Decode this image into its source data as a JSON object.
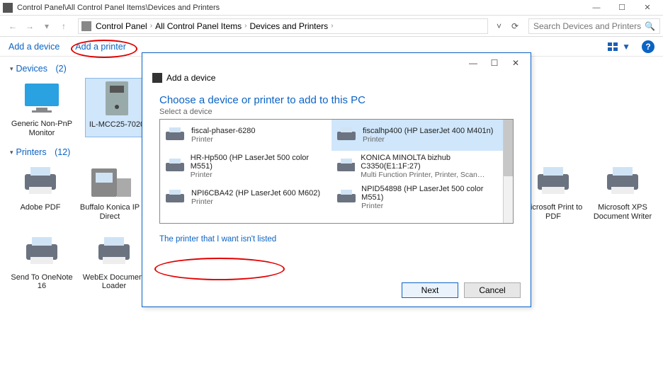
{
  "window": {
    "title": "Control Panel\\All Control Panel Items\\Devices and Printers"
  },
  "breadcrumbs": {
    "items": [
      "Control Panel",
      "All Control Panel Items",
      "Devices and Printers"
    ]
  },
  "search": {
    "placeholder": "Search Devices and Printers"
  },
  "cmdbar": {
    "add_device": "Add a device",
    "add_printer": "Add a printer"
  },
  "groups": {
    "devices": {
      "label": "Devices",
      "count": "(2)"
    },
    "printers": {
      "label": "Printers",
      "count": "(12)"
    }
  },
  "devices": [
    {
      "label": "Generic Non-PnP Monitor",
      "type": "monitor",
      "selected": false
    },
    {
      "label": "IL-MCC25-7020",
      "type": "pc",
      "selected": true
    }
  ],
  "printers": [
    {
      "label": "Adobe PDF"
    },
    {
      "label": "Buffalo Konica IP Direct"
    },
    {
      "label": "Microsoft Print to PDF"
    },
    {
      "label": "Microsoft XPS Document Writer"
    },
    {
      "label": "Send To OneNote 16"
    },
    {
      "label": "WebEx Document Loader"
    }
  ],
  "modal": {
    "header": "Add a device",
    "choose": "Choose a device or printer to add to this PC",
    "select": "Select a device",
    "notlisted": "The printer that I want isn't listed",
    "next": "Next",
    "cancel": "Cancel",
    "left": [
      {
        "name": "fiscal-phaser-6280",
        "type": "Printer"
      },
      {
        "name": "HR-Hp500 (HP LaserJet 500 color M551)",
        "type": "Printer"
      },
      {
        "name": "NPI6CBA42 (HP LaserJet 600 M602)",
        "type": "Printer"
      }
    ],
    "right": [
      {
        "name": "fiscalhp400 (HP LaserJet 400 M401n)",
        "type": "Printer",
        "selected": true
      },
      {
        "name": "KONICA MINOLTA bizhub C3350(E1:1F:27)",
        "type": "Multi Function Printer, Printer, Scan…"
      },
      {
        "name": "NPID54898 (HP LaserJet 500 color M551)",
        "type": "Printer"
      }
    ]
  }
}
